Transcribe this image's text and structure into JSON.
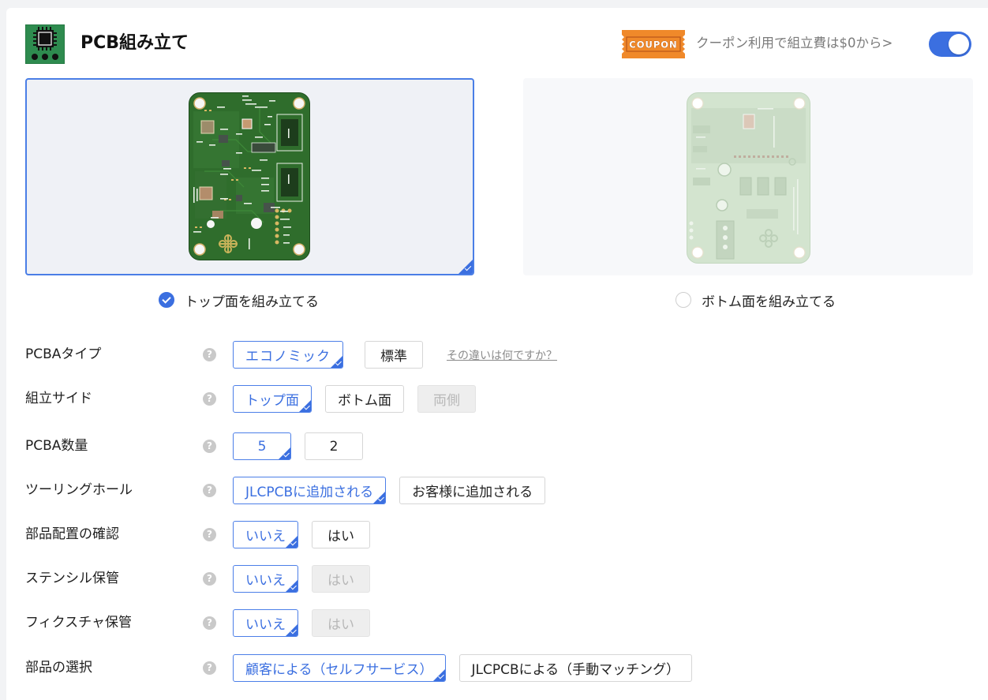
{
  "header": {
    "title": "PCB組み立て",
    "coupon_badge": "COUPON",
    "coupon_text": "クーポン利用で組立費は$0から>",
    "toggle_on": true
  },
  "assembly_preview": {
    "top": {
      "label": "トップ面を組み立てる",
      "selected": true
    },
    "bottom": {
      "label": "ボトム面を組み立てる",
      "selected": false
    }
  },
  "form": {
    "pcba_type": {
      "label": "PCBAタイプ",
      "options": [
        {
          "label": "エコノミック",
          "state": "selected"
        },
        {
          "label": "標準",
          "state": "default"
        }
      ],
      "help_link": "その違いは何ですか？"
    },
    "assembly_side": {
      "label": "組立サイド",
      "options": [
        {
          "label": "トップ面",
          "state": "selected"
        },
        {
          "label": "ボトム面",
          "state": "default"
        },
        {
          "label": "両側",
          "state": "disabled"
        }
      ]
    },
    "pcba_qty": {
      "label": "PCBA数量",
      "options": [
        {
          "label": "5",
          "state": "selected"
        },
        {
          "label": "2",
          "state": "default"
        }
      ]
    },
    "tooling_holes": {
      "label": "ツーリングホール",
      "options": [
        {
          "label": "JLCPCBに追加される",
          "state": "selected"
        },
        {
          "label": "お客様に追加される",
          "state": "default"
        }
      ]
    },
    "confirm_placement": {
      "label": "部品配置の確認",
      "options": [
        {
          "label": "いいえ",
          "state": "selected"
        },
        {
          "label": "はい",
          "state": "default"
        }
      ]
    },
    "stencil_storage": {
      "label": "ステンシル保管",
      "options": [
        {
          "label": "いいえ",
          "state": "selected"
        },
        {
          "label": "はい",
          "state": "disabled"
        }
      ]
    },
    "fixture_storage": {
      "label": "フィクスチャ保管",
      "options": [
        {
          "label": "いいえ",
          "state": "selected"
        },
        {
          "label": "はい",
          "state": "disabled"
        }
      ]
    },
    "parts_selection": {
      "label": "部品の選択",
      "options": [
        {
          "label": "顧客による（セルフサービス）",
          "state": "selected"
        },
        {
          "label": "JLCPCBによる（手動マッチング）",
          "state": "default"
        }
      ]
    }
  },
  "icons": {
    "header": "pcb-chip-icon",
    "coupon": "coupon-ticket-icon",
    "help": "question-circle-icon",
    "selected_corner": "check-corner-icon",
    "radio_checked": "check-circle-icon"
  },
  "colors": {
    "accent": "#3b6fe0",
    "coupon_orange": "#f0892a",
    "pcb_green": "#2f6d2c",
    "pcb_faded": "#d3e4cf",
    "text": "#1f1f1f",
    "muted": "#8a8a8a",
    "disabled_bg": "#eeeeee"
  }
}
